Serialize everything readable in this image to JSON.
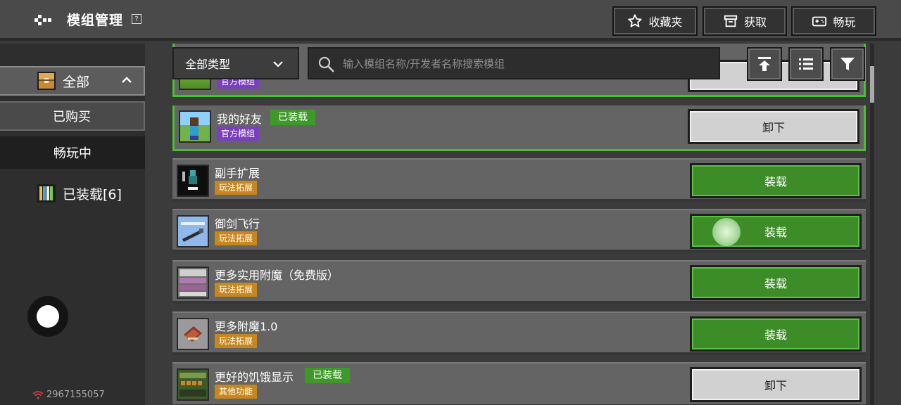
{
  "header": {
    "title": "模组管理",
    "help_label": "?",
    "favorites_label": "收藏夹",
    "get_label": "获取",
    "play_label": "畅玩"
  },
  "sidebar": {
    "items": [
      {
        "label": "全部"
      },
      {
        "label": "已购买"
      },
      {
        "label": "畅玩中"
      },
      {
        "label": "已装载[6]"
      }
    ],
    "footer_id": "2967155057"
  },
  "filter": {
    "type_selected": "全部类型",
    "search_placeholder": "输入模组名称/开发者名称搜索模组"
  },
  "mods": [
    {
      "name": "",
      "tag": "官方模组",
      "action": ""
    },
    {
      "name": "我的好友",
      "tag": "官方模组",
      "badge": "已装载",
      "action": "卸下"
    },
    {
      "name": "副手扩展",
      "tag": "玩法拓展",
      "action": "装载"
    },
    {
      "name": "御剑飞行",
      "tag": "玩法拓展",
      "action": "装载"
    },
    {
      "name": "更多实用附魔（免费版）",
      "tag": "玩法拓展",
      "action": "装载"
    },
    {
      "name": "更多附魔1.0",
      "tag": "玩法拓展",
      "action": "装载"
    },
    {
      "name": "更好的饥饿显示",
      "tag": "其他功能",
      "badge": "已装载",
      "action": "卸下"
    }
  ],
  "colors": {
    "accent_green": "#3c8c27",
    "active_border": "#49c030",
    "tag_purple": "#7a3fc0",
    "tag_orange": "#c8871d"
  }
}
